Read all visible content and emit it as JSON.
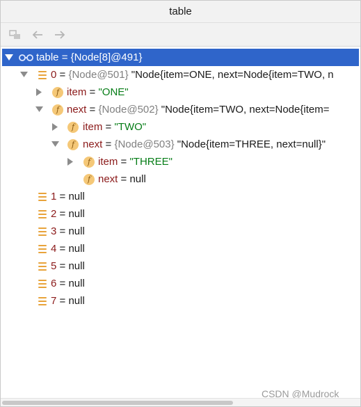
{
  "window": {
    "title": "table"
  },
  "toolbar": {
    "buttons": [
      {
        "name": "evaluate-icon",
        "enabled": false
      },
      {
        "name": "back-arrow-icon",
        "enabled": false
      },
      {
        "name": "forward-arrow-icon",
        "enabled": false
      }
    ]
  },
  "tree": {
    "root": {
      "name": "table",
      "eq": " = ",
      "value": "{Node[8]@491}"
    },
    "n0": {
      "name": "0",
      "eq": " = ",
      "ref": "{Node@501}",
      "str": " \"Node{item=ONE, next=Node{item=TWO, n"
    },
    "n0_item": {
      "name": "item",
      "eq": " = ",
      "str": "\"ONE\""
    },
    "n0_next": {
      "name": "next",
      "eq": " = ",
      "ref": "{Node@502}",
      "str": " \"Node{item=TWO, next=Node{item="
    },
    "n1_item": {
      "name": "item",
      "eq": " = ",
      "str": "\"TWO\""
    },
    "n1_next": {
      "name": "next",
      "eq": " = ",
      "ref": "{Node@503}",
      "str": " \"Node{item=THREE, next=null}\""
    },
    "n2_item": {
      "name": "item",
      "eq": " = ",
      "str": "\"THREE\""
    },
    "n2_next": {
      "name": "next",
      "eq": " = ",
      "val": "null"
    },
    "slots": [
      {
        "name": "1",
        "eq": " = ",
        "val": "null"
      },
      {
        "name": "2",
        "eq": " = ",
        "val": "null"
      },
      {
        "name": "3",
        "eq": " = ",
        "val": "null"
      },
      {
        "name": "4",
        "eq": " = ",
        "val": "null"
      },
      {
        "name": "5",
        "eq": " = ",
        "val": "null"
      },
      {
        "name": "6",
        "eq": " = ",
        "val": "null"
      },
      {
        "name": "7",
        "eq": " = ",
        "val": "null"
      }
    ]
  },
  "watermark": "CSDN @Mudrock__",
  "colors": {
    "selection": "#2f65ca",
    "field_name": "#8b1a1a",
    "string_value": "#067d17",
    "reference": "#808080",
    "field_icon": "#f5c878",
    "array_icon": "#e8a33a"
  }
}
